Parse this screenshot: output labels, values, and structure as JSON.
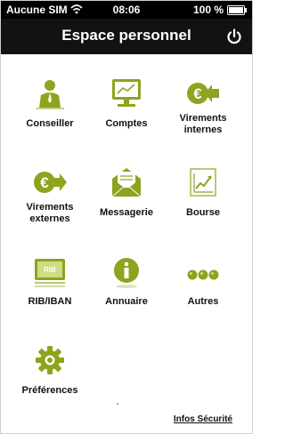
{
  "status_bar": {
    "carrier": "Aucune SIM",
    "time": "08:06",
    "battery": "100 %"
  },
  "header": {
    "title": "Espace personnel"
  },
  "accent_color": "#8ea31e",
  "tiles": [
    {
      "label": "Conseiller",
      "icon": "advisor-icon"
    },
    {
      "label": "Comptes",
      "icon": "accounts-icon"
    },
    {
      "label": "Virements internes",
      "icon": "internal-transfer-icon"
    },
    {
      "label": "Virements externes",
      "icon": "external-transfer-icon"
    },
    {
      "label": "Messagerie",
      "icon": "mail-icon"
    },
    {
      "label": "Bourse",
      "icon": "stock-chart-icon"
    },
    {
      "label": "RIB/IBAN",
      "icon": "rib-card-icon"
    },
    {
      "label": "Annuaire",
      "icon": "info-icon"
    },
    {
      "label": "Autres",
      "icon": "more-dots-icon"
    },
    {
      "label": "Préférences",
      "icon": "gear-icon"
    }
  ],
  "footer": {
    "link": "Infos Sécurité"
  }
}
